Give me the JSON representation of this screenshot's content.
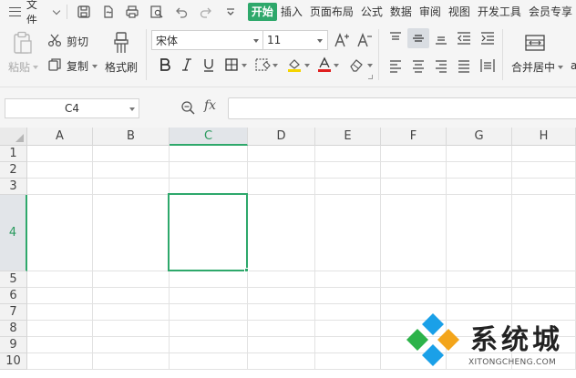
{
  "menubar": {
    "file_label": "文件",
    "tabs": [
      {
        "label": "开始",
        "active": true
      },
      {
        "label": "插入",
        "active": false
      },
      {
        "label": "页面布局",
        "active": false
      },
      {
        "label": "公式",
        "active": false
      },
      {
        "label": "数据",
        "active": false
      },
      {
        "label": "审阅",
        "active": false
      },
      {
        "label": "视图",
        "active": false
      },
      {
        "label": "开发工具",
        "active": false
      },
      {
        "label": "会员专享",
        "active": false
      }
    ],
    "accent_color": "#2ea86b"
  },
  "ribbon": {
    "paste_label": "粘贴",
    "cut_label": "剪切",
    "copy_label": "复制",
    "format_painter_label": "格式刷",
    "font_name": "宋体",
    "font_size": "11",
    "merge_label": "合并居中",
    "font_color": "#e02020",
    "fill_color": "#f5d400"
  },
  "formula_bar": {
    "name_box_value": "C4",
    "fx_label": "fx",
    "formula_value": ""
  },
  "grid": {
    "columns": [
      "A",
      "B",
      "C",
      "D",
      "E",
      "F",
      "G",
      "H"
    ],
    "rows": [
      "1",
      "2",
      "3",
      "4",
      "5",
      "6",
      "7",
      "8",
      "9",
      "10"
    ],
    "selected_column": "C",
    "selected_row": "4",
    "active_cell": "C4",
    "selection_color": "#2ea86b"
  },
  "watermark": {
    "title": "系统城",
    "subtitle": "XITONGCHENG.COM",
    "logo_colors": [
      "#1aa0e8",
      "#2db34a",
      "#f3a51b",
      "#1aa0e8"
    ]
  }
}
